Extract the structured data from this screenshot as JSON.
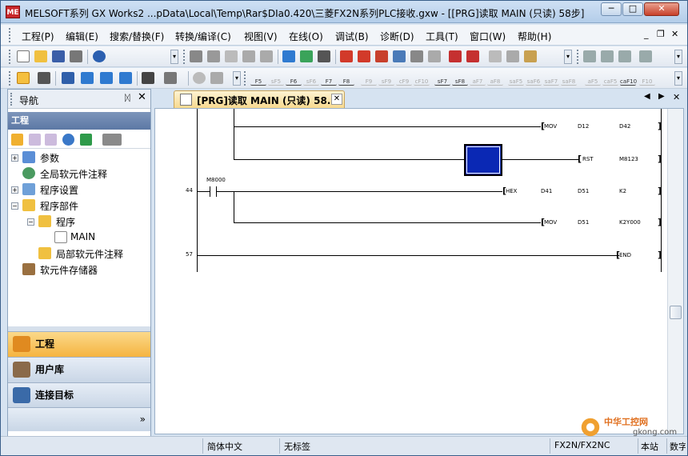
{
  "window": {
    "title": "MELSOFT系列 GX Works2 ...pData\\Local\\Temp\\Rar$DIa0.420\\三菱FX2N系列PLC接收.gxw - [[PRG]读取 MAIN (只读) 58步]",
    "app_icon_text": "ME",
    "min": "─",
    "max": "□",
    "close": "✕"
  },
  "menu": {
    "items": [
      "工程(P)",
      "编辑(E)",
      "搜索/替换(F)",
      "转换/编译(C)",
      "视图(V)",
      "在线(O)",
      "调试(B)",
      "诊断(D)",
      "工具(T)",
      "窗口(W)",
      "帮助(H)"
    ],
    "mdi_min": "_",
    "mdi_restore": "❐",
    "mdi_close": "✕"
  },
  "toolbar3": {
    "fkeys": [
      "F5",
      "sF5",
      "F6",
      "sF6",
      "F7",
      "F8",
      "F9",
      "sF9",
      "cF9",
      "cF10",
      "sF7",
      "sF8",
      "aF7",
      "aF8",
      "saF5",
      "saF6",
      "saF7",
      "saF8",
      "aF5",
      "caF5",
      "caF10",
      "F10"
    ]
  },
  "nav": {
    "title": "导航",
    "pin": "ᛞ",
    "close": "✕",
    "section": "工程",
    "tree": [
      {
        "label": "参数",
        "pm": "+",
        "level": 0
      },
      {
        "label": "全局软元件注释",
        "pm": "",
        "level": 0
      },
      {
        "label": "程序设置",
        "pm": "+",
        "level": 0
      },
      {
        "label": "程序部件",
        "pm": "−",
        "level": 0
      },
      {
        "label": "程序",
        "pm": "−",
        "level": 1
      },
      {
        "label": "MAIN",
        "pm": "",
        "level": 2
      },
      {
        "label": "局部软元件注释",
        "pm": "",
        "level": 1
      },
      {
        "label": "软元件存储器",
        "pm": "",
        "level": 0
      }
    ],
    "buttons": [
      "工程",
      "用户库",
      "连接目标"
    ],
    "more": "»"
  },
  "doc": {
    "tab_title": "[PRG]读取 MAIN (只读) 58...",
    "tab_close": "✕",
    "prev": "◀",
    "next": "▶"
  },
  "ladder": {
    "steps": [
      "44",
      "57"
    ],
    "contact": "M8000",
    "rows": [
      {
        "instr": "MOV",
        "a": "D12",
        "b": "D42"
      },
      {
        "instr": "RST",
        "a": "",
        "b": "M8123"
      },
      {
        "instr": "HEX",
        "a": "D41",
        "b": "D51",
        "c": "K2"
      },
      {
        "instr": "MOV",
        "a": "D51",
        "b": "K2Y000"
      },
      {
        "instr": "END"
      }
    ]
  },
  "status": {
    "lang": "简体中文",
    "title": "无标签",
    "plc": "FX2N/FX2NC",
    "station": "本站",
    "extra": "数字"
  },
  "watermark": {
    "cn": "中华工控网",
    "url": "gkong.com"
  }
}
